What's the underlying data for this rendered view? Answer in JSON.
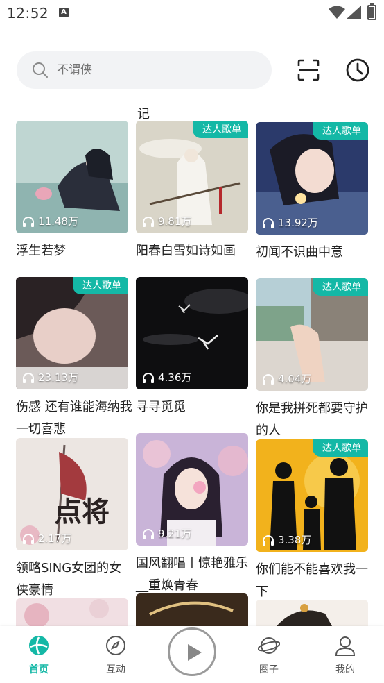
{
  "status": {
    "time": "12:52",
    "notif_letter": "A"
  },
  "search": {
    "placeholder": "不谓侠"
  },
  "remnants": {
    "col2": "记"
  },
  "tag_label": "达人歌单",
  "cards": [
    {
      "title": "浮生若梦",
      "plays": "11.48万",
      "tag": false
    },
    {
      "title": "阳春白雪如诗如画",
      "plays": "9.81万",
      "tag": true
    },
    {
      "title": "初闻不识曲中意",
      "plays": "13.92万",
      "tag": true
    },
    {
      "title": "伤感 还有谁能海纳我一切喜悲",
      "plays": "23.13万",
      "tag": true
    },
    {
      "title": "寻寻觅觅",
      "plays": "4.36万",
      "tag": false
    },
    {
      "title": "你是我拼死都要守护的人",
      "plays": "4.04万",
      "tag": true
    },
    {
      "title": "领略SING女团的女侠豪情",
      "plays": "2.17万",
      "tag": false
    },
    {
      "title": "国风翻唱丨惊艳雅乐__重焕青春",
      "plays": "9.21万",
      "tag": false
    },
    {
      "title": "你们能不能喜欢我一下",
      "plays": "3.38万",
      "tag": true
    }
  ],
  "nav": {
    "home": "首页",
    "interact": "互动",
    "circle": "圈子",
    "mine": "我的"
  },
  "colors": {
    "accent": "#14b8a6"
  }
}
